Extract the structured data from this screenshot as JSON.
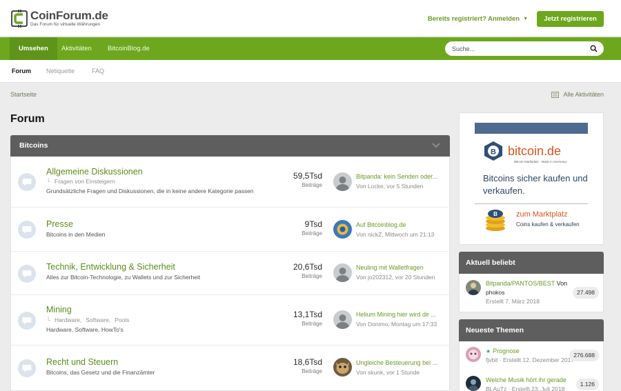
{
  "header": {
    "logo_name": "CoinForum.de",
    "logo_tagline": "Das Forum für virtuelle Währungen",
    "login_label": "Bereits registriert? Anmelden",
    "register_label": "Jetzt registrieren"
  },
  "nav": {
    "tabs": [
      "Umsehen",
      "Aktivitäten",
      "BitcoinBlog.de"
    ],
    "search_placeholder": "Suche..."
  },
  "subnav": {
    "items": [
      "Forum",
      "Netiquette",
      "FAQ"
    ]
  },
  "breadcrumb": "Startseite",
  "all_activities": "Alle Aktivitäten",
  "page_title": "Forum",
  "category": {
    "title": "Bitcoins",
    "nodes": [
      {
        "title": "Allgemeine Diskussionen",
        "sub": [
          "Fragen von Einsteigern"
        ],
        "desc": "Grundsätzliche Fragen und Diskussionen, die in keine andere Kategorie passen",
        "stat": "59,5Tsd",
        "stat_label": "Beiträge",
        "last_title": "Bitpanda: kein Senden oder...",
        "last_meta": "Von Locke, vor 5 Stunden"
      },
      {
        "title": "Presse",
        "sub": [],
        "desc": "Bitcoins in den Medien",
        "stat": "9Tsd",
        "stat_label": "Beiträge",
        "last_title": "Auf Bitcoinblog.de",
        "last_meta": "Von nickZ, Mittwoch um 21:13"
      },
      {
        "title": "Technik, Entwicklung & Sicherheit",
        "sub": [],
        "desc": "Alles zur Bitcoin-Technologie, zu Wallets und zur Sicherheit",
        "stat": "20,6Tsd",
        "stat_label": "Beiträge",
        "last_title": "Neuling mit Walletfragen",
        "last_meta": "Von jo202312, vor 20 Stunden"
      },
      {
        "title": "Mining",
        "sub": [
          "Hardware,",
          "Software,",
          "Pools"
        ],
        "desc": "Hardware, Software, HowTo's",
        "stat": "13,1Tsd",
        "stat_label": "Beiträge",
        "last_title": "Helium Mining hier wird dir ...",
        "last_meta": "Von Donimo, Montag um 17:33"
      },
      {
        "title": "Recht und Steuern",
        "sub": [],
        "desc": "Bitcoins, das Gesetz und die Finanzämter",
        "stat": "18,6Tsd",
        "stat_label": "Beiträge",
        "last_title": "Ungleiche Besteuerung bei ...",
        "last_meta": "Von skunk, vor 1 Stunde"
      }
    ]
  },
  "ad": {
    "brand": "bitcoin.de",
    "tagline": "Bitcoin-Marktplatz · Made in Germany!",
    "headline": "Bitcoins sicher kaufen und verkaufen.",
    "cta": "zum Marktplatz",
    "cta_sub": "Coins kaufen & verkaufen"
  },
  "popular": {
    "title": "Aktuell beliebt",
    "items": [
      {
        "title": "Bitpanda/PANTOS/BEST",
        "by": "Von",
        "line2": "phokos",
        "meta": "Erstellt 7. März 2018",
        "count": "27.498"
      }
    ]
  },
  "newest": {
    "title": "Neueste Themen",
    "items": [
      {
        "title": "Prognose",
        "meta": "fjvbit · Erstellt 12. Dezember 2017",
        "count": "276.688"
      },
      {
        "title": "Welche Musik hört ihr gerade",
        "meta": "BLAuTz · Erstellt 23. Juli 2018",
        "count": "1.126"
      }
    ]
  },
  "colors": {
    "brand_green": "#6da71e",
    "block_header": "#5e5e5e",
    "link_green": "#6a9a23"
  }
}
